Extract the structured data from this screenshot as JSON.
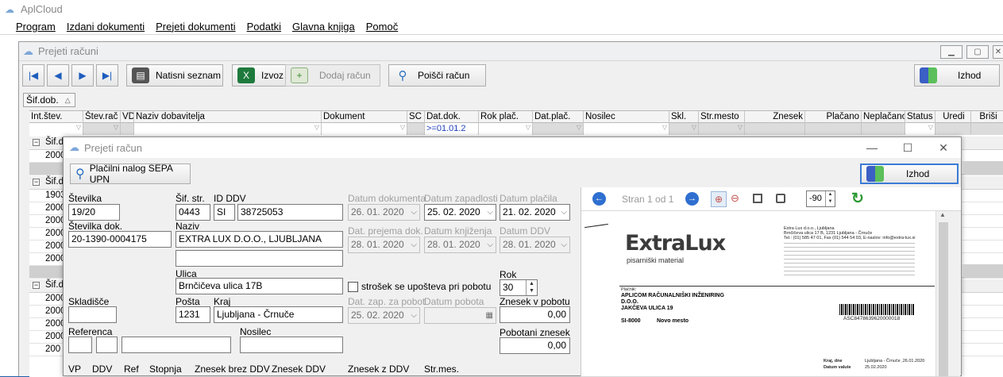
{
  "app": {
    "title": "AplCloud"
  },
  "menu": [
    {
      "label": "Program",
      "accesskey_underlined": true
    },
    {
      "label": "Izdani dokumenti",
      "accesskey_underlined": true
    },
    {
      "label": "Prejeti dokumenti",
      "accesskey_underlined": true
    },
    {
      "label": "Podatki",
      "accesskey_underlined": true
    },
    {
      "label": "Glavna knjiga",
      "accesskey_underlined": true
    },
    {
      "label": "Pomoč",
      "accesskey_underlined": true
    }
  ],
  "list_window": {
    "title": "Prejeti računi",
    "toolbar": {
      "first": "|◀",
      "prev": "◀",
      "next": "▶",
      "last": "▶|",
      "print_label": "Natisni seznam",
      "export_label": "Izvoz",
      "add_label": "Dodaj račun",
      "search_label": "Poišči račun",
      "exit_label": "Izhod"
    },
    "group_by": "Šif.dob.",
    "columns": [
      "Int.štev.",
      "Štev.rač",
      "VD",
      "Naziv dobavitelja",
      "Dokument",
      "SC",
      "Dat.dok.",
      "Rok plač.",
      "Dat.plač.",
      "Nosilec",
      "Skl.",
      "Str.mesto",
      "Znesek",
      "Plačano",
      "Neplačano",
      "Status",
      "Uredi",
      "Briši"
    ],
    "filter_dat_dok": ">=01.01.2",
    "groups": [
      {
        "label": "Šif.d",
        "rows": [
          "2000"
        ]
      },
      {
        "label": "Šif.d",
        "rows": [
          "1903",
          "2000",
          "2000",
          "2000",
          "2000",
          "2000"
        ]
      },
      {
        "label": "Šif.d",
        "rows": [
          "2000",
          "2000",
          "2000",
          "2000",
          "200"
        ]
      }
    ]
  },
  "dialog": {
    "title": "Prejeti račun",
    "sepa_label": "Plačilni nalog SEPA UPN",
    "exit_label": "Izhod",
    "labels": {
      "stevilka": "Številka",
      "sif_str": "Šif. str.",
      "id_ddv": "ID DDV",
      "datum_dokumenta": "Datum dokumenta",
      "datum_zapadlosti": "Datum zapadlosti",
      "datum_placila": "Datum plačila",
      "stevilka_dok": "Številka dok.",
      "naziv": "Naziv",
      "dat_prejema": "Dat. prejema dok.",
      "datum_knjizenja": "Datum knjiženja",
      "datum_ddv": "Datum DDV",
      "ulica": "Ulica",
      "strosek": "strošek se upošteva pri pobotu",
      "rok": "Rok",
      "skladisce": "Skladišče",
      "posta": "Pošta",
      "kraj": "Kraj",
      "dat_zap_pobot": "Dat. zap. za pobot",
      "datum_pobota": "Datum pobota",
      "znesek_v_pobotu": "Znesek v pobotu",
      "referenca": "Referenca",
      "nosilec": "Nosilec",
      "pobotani_znesek": "Pobotani znesek",
      "vp": "VP",
      "ddv": "DDV",
      "ref": "Ref",
      "stopnja": "Stopnja",
      "znesek_brez_ddv": "Znesek brez DDV",
      "znesek_ddv": "Znesek DDV",
      "znesek_z_ddv": "Znesek z DDV",
      "str_mes": "Str.mes."
    },
    "values": {
      "stevilka": "19/20",
      "sif_str": "0443",
      "id_ddv_prefix": "SI",
      "id_ddv": "38725053",
      "datum_dokumenta": "26. 01. 2020",
      "datum_zapadlosti": "25. 02. 2020",
      "datum_placila": "21. 02. 2020",
      "stevilka_dok": "20-1390-0004175",
      "naziv": "EXTRA LUX D.O.O., LJUBLJANA",
      "naziv2": "",
      "dat_prejema": "28. 01. 2020",
      "datum_knjizenja": "28. 01. 2020",
      "datum_ddv": "28. 01. 2020",
      "ulica": "Brnčičeva ulica 17B",
      "rok": "30",
      "skladisce": "",
      "posta": "1231",
      "kraj": "Ljubljana - Črnuče",
      "dat_zap_pobot": "25. 02. 2020",
      "datum_pobota": "",
      "znesek_v_pobotu": "0,00",
      "pobotani_znesek": "0,00"
    },
    "preview": {
      "page_label": "Stran 1 od 1",
      "rotation": "-90",
      "doc": {
        "brand": "ExtraLux",
        "brand_sub": "pisarniški material",
        "company_line1": "Extra Lux d.o.o., Ljubljana",
        "company_line2": "Brnčičeva ulica 17 B, 1231 Ljubljana - Črnuče",
        "company_line3": "Tel.: (01) 585 47 01, Fax (01) 544 54 03, E-naslov: info@extra-lux.si",
        "payer_label": "Plačnik:",
        "payer_name": "APLICOM RAČUNALNIŠKI INŽENIRING",
        "payer_form": "D.O.O.",
        "payer_street": "JAKČEVA ULICA 19",
        "payer_post": "SI-8000",
        "payer_city": "Novo mesto",
        "barcode_text": "ASC8478639620000018",
        "place_label": "Kraj, dne",
        "place_value": "Ljubljana - Črnuče ,26.01.2020",
        "due_label": "Datum valute",
        "due_value": "25.02.2020"
      }
    }
  }
}
